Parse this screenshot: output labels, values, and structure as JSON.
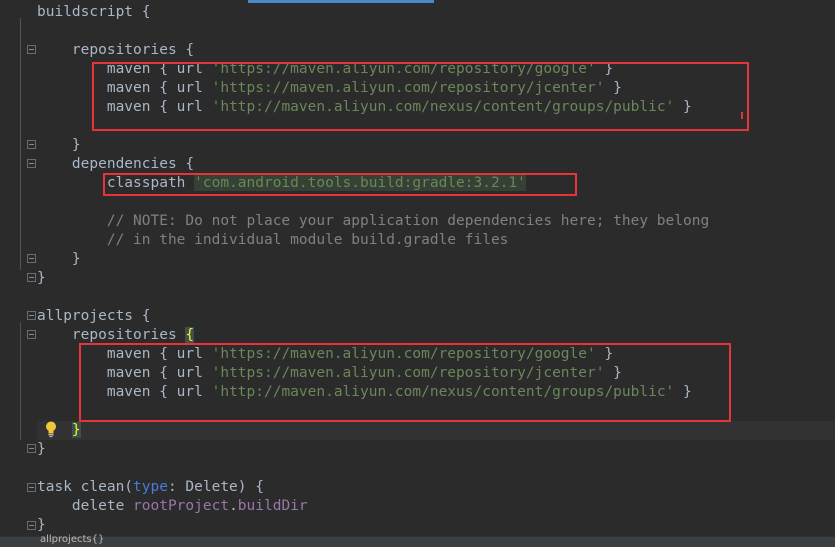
{
  "editor": {
    "lines": [
      [
        {
          "t": "buildscript {"
        }
      ],
      [
        {
          "t": ""
        }
      ],
      [
        {
          "t": "    repositories {"
        }
      ],
      [
        {
          "t": "        maven { url "
        },
        {
          "t": "'https://maven.aliyun.com/repository/google'",
          "c": "str"
        },
        {
          "t": " }"
        }
      ],
      [
        {
          "t": "        maven { url "
        },
        {
          "t": "'https://maven.aliyun.com/repository/jcenter'",
          "c": "str"
        },
        {
          "t": " }"
        }
      ],
      [
        {
          "t": "        maven { url "
        },
        {
          "t": "'http://maven.aliyun.com/nexus/content/groups/public'",
          "c": "str"
        },
        {
          "t": " }"
        }
      ],
      [
        {
          "t": ""
        }
      ],
      [
        {
          "t": "    }"
        }
      ],
      [
        {
          "t": "    dependencies {"
        }
      ],
      [
        {
          "t": "        classpath "
        },
        {
          "t": "'com.android.tools.build:gradle:3.2.1'",
          "c": "str hl-str"
        }
      ],
      [
        {
          "t": ""
        }
      ],
      [
        {
          "t": "        // NOTE: Do not place your application dependencies here; they belong",
          "c": "cmt"
        }
      ],
      [
        {
          "t": "        // in the individual module build.gradle files",
          "c": "cmt"
        }
      ],
      [
        {
          "t": "    }"
        }
      ],
      [
        {
          "t": "}"
        }
      ],
      [
        {
          "t": ""
        }
      ],
      [
        {
          "t": "allprojects {"
        }
      ],
      [
        {
          "t": "    repositories "
        },
        {
          "t": "{",
          "c": "brace-hl"
        }
      ],
      [
        {
          "t": "        maven { url "
        },
        {
          "t": "'https://maven.aliyun.com/repository/google'",
          "c": "str"
        },
        {
          "t": " }"
        }
      ],
      [
        {
          "t": "        maven { url "
        },
        {
          "t": "'https://maven.aliyun.com/repository/jcenter'",
          "c": "str"
        },
        {
          "t": " }"
        }
      ],
      [
        {
          "t": "        maven { url "
        },
        {
          "t": "'http://maven.aliyun.com/nexus/content/groups/public'",
          "c": "str"
        },
        {
          "t": " }"
        }
      ],
      [
        {
          "t": ""
        }
      ],
      [
        {
          "t": "    "
        },
        {
          "t": "}",
          "c": "brace-hl"
        }
      ],
      [
        {
          "t": "}"
        }
      ],
      [
        {
          "t": ""
        }
      ],
      [
        {
          "t": "task clean("
        },
        {
          "t": "type",
          "c": "param"
        },
        {
          "t": ": Delete) {"
        }
      ],
      [
        {
          "t": "    delete "
        },
        {
          "t": "rootProject",
          "c": "prop"
        },
        {
          "t": "."
        },
        {
          "t": "buildDir",
          "c": "prop"
        }
      ],
      [
        {
          "t": "}"
        }
      ]
    ],
    "current_line_index": 22
  },
  "status_bar": {
    "breadcrumb": "allprojects{}"
  },
  "colors": {
    "annotation_box": "#e8333a",
    "background": "#2b2b2b",
    "string": "#6a8759",
    "comment": "#808080"
  },
  "icons": {
    "intention": "lightbulb-icon"
  }
}
